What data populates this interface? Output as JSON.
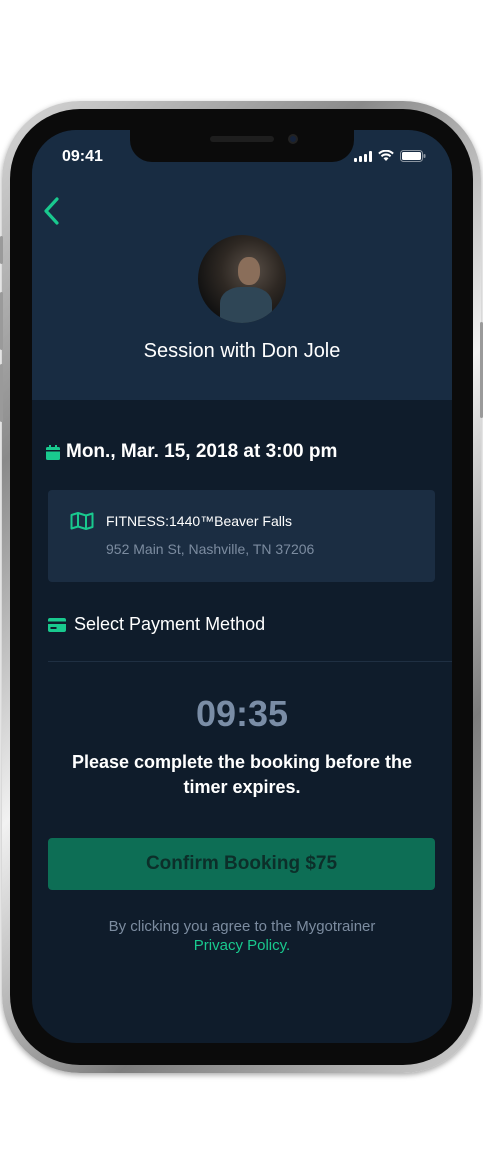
{
  "status_bar": {
    "time": "09:41"
  },
  "session": {
    "title": "Session with  Don Jole"
  },
  "booking": {
    "date": "Mon., Mar. 15, 2018 at 3:00 pm",
    "location_name": "FITNESS:1440™Beaver Falls",
    "location_address": "952 Main St, Nashville, TN 37206"
  },
  "payment": {
    "label": "Select Payment Method"
  },
  "timer": {
    "value": "09:35",
    "notice": "Please complete the booking before the timer expires."
  },
  "confirm": {
    "label": "Confirm Booking $75"
  },
  "footer": {
    "agree_text": "By clicking you agree to the Mygotrainer",
    "privacy_link": "Privacy Policy."
  },
  "colors": {
    "accent": "#19c98e",
    "background": "#0f1c2b",
    "header": "#182c42",
    "button": "#0d6e55"
  },
  "icons": [
    "back-chevron-icon",
    "calendar-icon",
    "map-icon",
    "card-icon",
    "signal-icon",
    "wifi-icon",
    "battery-icon"
  ]
}
